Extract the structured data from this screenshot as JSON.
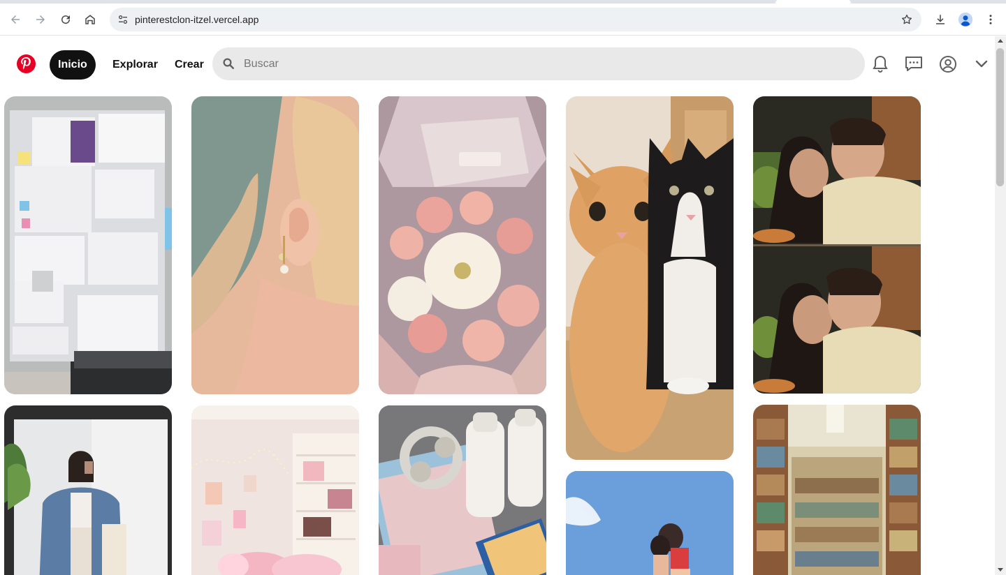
{
  "browser": {
    "url": "pinterestclon-itzel.vercel.app",
    "icons": [
      "back-icon",
      "forward-icon",
      "reload-icon",
      "home-icon",
      "site-info-icon",
      "bookmark-star-icon",
      "download-icon",
      "profile-icon",
      "menu-icon"
    ]
  },
  "header": {
    "nav": {
      "home": "Inicio",
      "explore": "Explorar",
      "create": "Crear"
    },
    "search": {
      "placeholder": "Buscar"
    },
    "icons": [
      "pinterest-logo-icon",
      "search-icon",
      "bell-icon",
      "messages-icon",
      "account-icon",
      "chevron-down-icon"
    ]
  },
  "pins": [
    {
      "subject": "study-wall",
      "colors": [
        "#b8bbb9",
        "#e9e9ec",
        "#5d5f61"
      ]
    },
    {
      "subject": "earring",
      "colors": [
        "#7f978f",
        "#e7c5a6",
        "#e9c79a"
      ]
    },
    {
      "subject": "flower-bouquet",
      "colors": [
        "#cbb8bd",
        "#e8a99b",
        "#f2ece3"
      ]
    },
    {
      "subject": "cats",
      "colors": [
        "#d8b48a",
        "#d89a5a",
        "#1d1b1c"
      ]
    },
    {
      "subject": "couple-kissing",
      "colors": [
        "#2a2a22",
        "#e7dcb6",
        "#4e3a2c"
      ]
    },
    {
      "subject": "mirror-selfie",
      "colors": [
        "#e7e8e9",
        "#5b7ca4",
        "#2d2d2d"
      ]
    },
    {
      "subject": "room-lights",
      "colors": [
        "#efe4df",
        "#f4b6c3",
        "#f7f1ea"
      ]
    },
    {
      "subject": "desk-flatlay",
      "colors": [
        "#6b6a6c",
        "#e8c7c9",
        "#f3f0eb"
      ]
    },
    {
      "subject": "beach-couple",
      "colors": [
        "#5a93d4",
        "#a9c9ef",
        "#ffffff"
      ]
    },
    {
      "subject": "library",
      "colors": [
        "#8a5a38",
        "#d9cfae",
        "#5c8a6a"
      ]
    }
  ]
}
